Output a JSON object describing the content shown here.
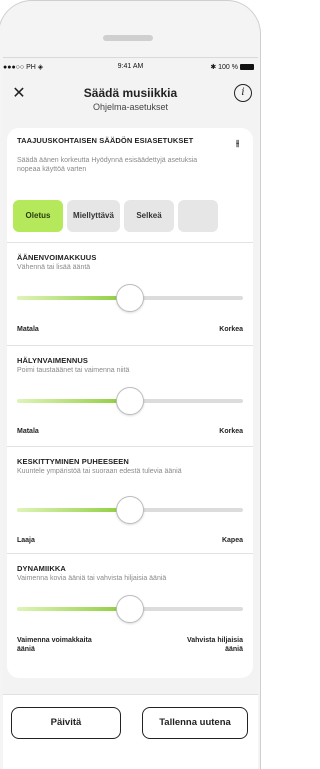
{
  "status_bar": {
    "carrier": "●●●○○ PH ◈",
    "time": "9:41 AM",
    "battery": "✱ 100 %"
  },
  "header": {
    "title": "Säädä musiikkia",
    "subtitle": "Ohjelma-asetukset"
  },
  "presets": {
    "title": "TAAJUUSKOHTAISEN SÄÄDÖN ESIASETUKSET",
    "description": "Säädä äänen korkeutta Hyödynnä esisäädettyjä asetuksia nopeaa käyttöä varten",
    "options": [
      "Oletus",
      "Miellyttävä",
      "Selkeä",
      ""
    ],
    "selected": "Oletus"
  },
  "volume": {
    "title": "ÄÄNENVOIMAKKUUS",
    "description": "Vähennä tai lisää ääntä",
    "min_label": "Matala",
    "max_label": "Korkea",
    "level": 0.5
  },
  "noise": {
    "title": "HÄLYNVAIMENNUS",
    "description": "Poimi taustaäänet tai vaimenna niitä",
    "min_label": "Matala",
    "max_label": "Korkea",
    "level": 0.5
  },
  "speech_focus": {
    "title": "KESKITTYMINEN PUHEESEEN",
    "description": "Kuuntele ympäristöä tai suoraan edestä tulevia ääniä",
    "min_label": "Laaja",
    "max_label": "Kapea",
    "level": 0.5
  },
  "dynamics": {
    "title": "DYNAMIIKKA",
    "description": "Vaimenna kovia ääniä tai vahvista hiljaisia ääniä",
    "min_label": "Vaimenna voimakkaita ääniä",
    "max_label": "Vahvista hiljaisia ääniä",
    "level": 0.5
  },
  "footer": {
    "update_label": "Päivitä",
    "save_new_label": "Tallenna uutena"
  },
  "colors": {
    "accent": "#b5e85a",
    "fill": "#8acb38",
    "track": "#dcdcdc"
  }
}
